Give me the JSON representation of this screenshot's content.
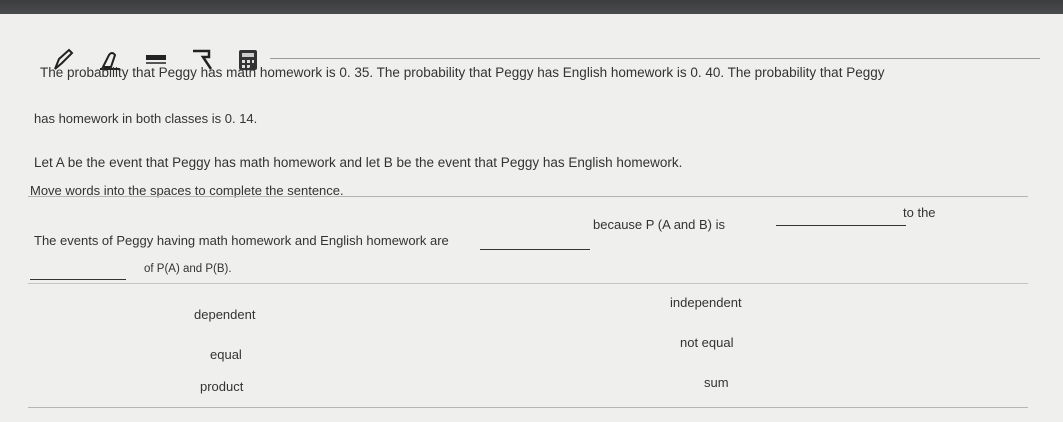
{
  "question": {
    "line1": "The probability that Peggy has math homework is 0. 35. The probability that Peggy has English homework is 0. 40. The probability that Peggy",
    "line2": "has homework in both classes is 0. 14.",
    "line3": "Let A be the event that Peggy has math homework and let B be the event that Peggy has English homework.",
    "instruction": "Move words into the spaces to complete the sentence."
  },
  "sentence": {
    "part1": "The events of Peggy having math homework and English homework are",
    "part2": "because P (A  and  B) is",
    "part3": "to the",
    "part4": "of P(A) and P(B)."
  },
  "choices": [
    "dependent",
    "independent",
    "equal",
    "not equal",
    "product",
    "sum"
  ],
  "toolbar": {
    "icons": [
      "pencil-icon",
      "eraser-icon",
      "highlighter-icon",
      "flag-icon",
      "calculator-icon"
    ]
  }
}
